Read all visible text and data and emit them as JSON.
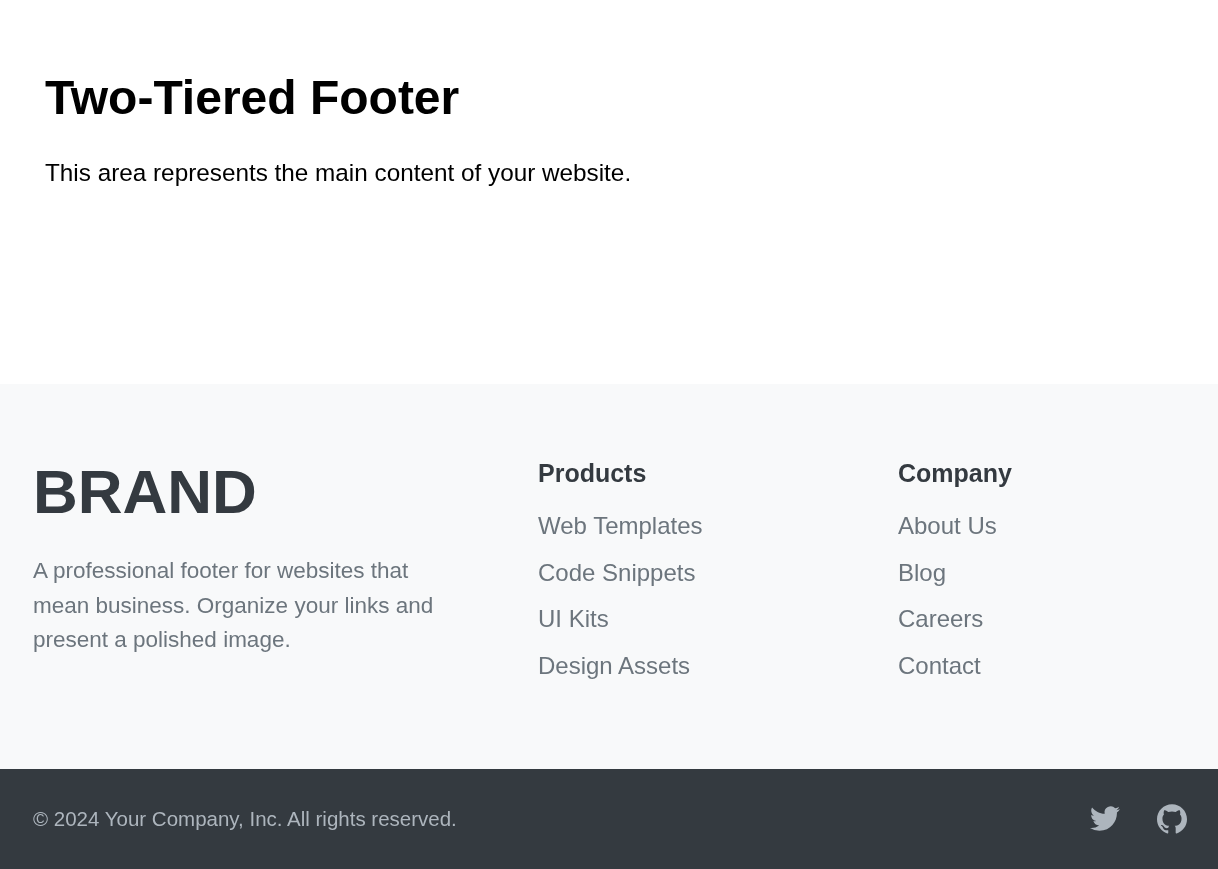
{
  "main": {
    "title": "Two-Tiered Footer",
    "text": "This area represents the main content of your website."
  },
  "footer": {
    "brand": {
      "logo": "BRAND",
      "description": "A professional footer for websites that mean business. Organize your links and present a polished image."
    },
    "columns": [
      {
        "heading": "Products",
        "links": [
          "Web Templates",
          "Code Snippets",
          "UI Kits",
          "Design Assets"
        ]
      },
      {
        "heading": "Company",
        "links": [
          "About Us",
          "Blog",
          "Careers",
          "Contact"
        ]
      }
    ]
  },
  "bottom_bar": {
    "copyright": "© 2024 Your Company, Inc. All rights reserved."
  }
}
